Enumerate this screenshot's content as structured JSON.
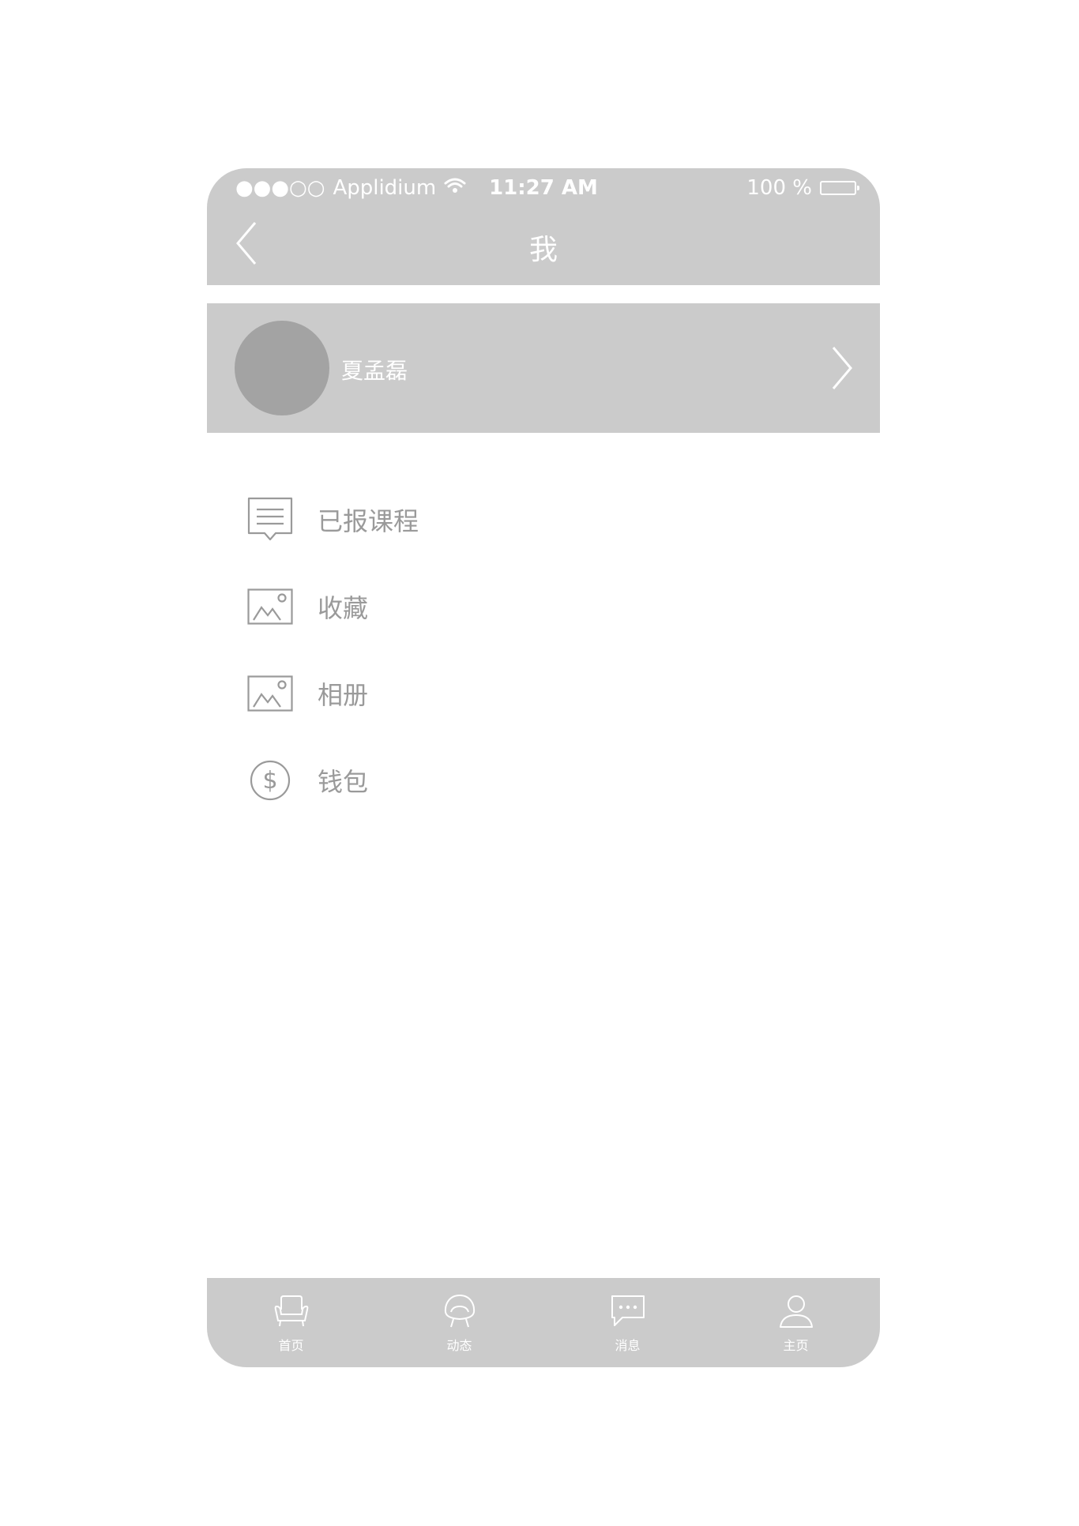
{
  "status_bar": {
    "signal": "●●●○○",
    "carrier": "Applidium",
    "time": "11:27 AM",
    "battery_text": "100 %"
  },
  "nav": {
    "title": "我"
  },
  "profile": {
    "name": "夏孟磊"
  },
  "menu": [
    {
      "label": "已报课程",
      "icon": "message-list-icon"
    },
    {
      "label": "收藏",
      "icon": "image-icon"
    },
    {
      "label": "相册",
      "icon": "image-icon"
    },
    {
      "label": "钱包",
      "icon": "dollar-coin-icon"
    }
  ],
  "tabs": [
    {
      "label": "首页",
      "icon": "armchair-icon"
    },
    {
      "label": "动态",
      "icon": "egg-chair-icon"
    },
    {
      "label": "消息",
      "icon": "chat-bubble-icon"
    },
    {
      "label": "主页",
      "icon": "user-icon"
    }
  ],
  "colors": {
    "bar_gray": "#cbcbcb",
    "avatar_gray": "#a3a3a3",
    "menu_text": "#9a9a9a",
    "white": "#ffffff"
  }
}
